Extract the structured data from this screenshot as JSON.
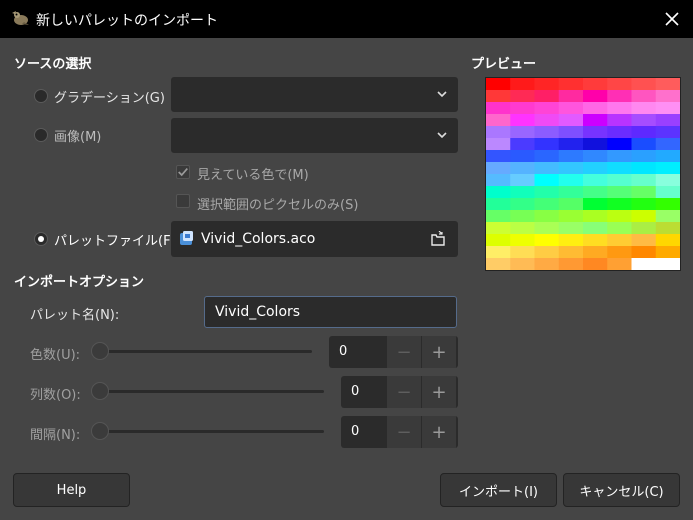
{
  "window": {
    "title": "新しいパレットのインポート",
    "app_icon": "gimp-wilber-icon",
    "close_icon": "close-icon"
  },
  "source": {
    "heading": "ソースの選択",
    "gradient": {
      "label": "グラデーション(G)",
      "selected": false,
      "value": ""
    },
    "image": {
      "label": "画像(M)",
      "selected": false,
      "value": ""
    },
    "visible_colors": {
      "label": "見えている色で(M)",
      "checked": true
    },
    "selection_only": {
      "label": "選択範囲のピクセルのみ(S)",
      "checked": false
    },
    "palette_file": {
      "label": "パレットファイル(F)",
      "selected": true,
      "file_name": "Vivid_Colors.aco"
    }
  },
  "preview": {
    "heading": "プレビュー",
    "swatches": [
      "#ff0000",
      "#ff1a1a",
      "#ff2525",
      "#ff3030",
      "#ff3b3b",
      "#ff4646",
      "#ff5151",
      "#ff5c5c",
      "#ff3838",
      "#ff2a55",
      "#ff1f66",
      "#ff2aa0",
      "#ff00aa",
      "#ff2fb5",
      "#ff55c0",
      "#ff70cc",
      "#ff33cc",
      "#ff3ad0",
      "#ff44d6",
      "#ff55dd",
      "#ff66e6",
      "#ff77ee",
      "#ff88f0",
      "#ff8ff4",
      "#ff66cc",
      "#ff33ff",
      "#f04af5",
      "#e25aff",
      "#cc00ff",
      "#b833ff",
      "#a64dff",
      "#9a40ff",
      "#aa77ff",
      "#9966ff",
      "#8c5cff",
      "#7f4fff",
      "#7733ff",
      "#6a2cff",
      "#5e29ff",
      "#5c33ff",
      "#bb88ff",
      "#4b3bff",
      "#3333ff",
      "#2222ee",
      "#1111dd",
      "#0000ff",
      "#1a4dff",
      "#3366ff",
      "#3355ff",
      "#2a5aff",
      "#2a66ff",
      "#2d7aff",
      "#3088ff",
      "#3399ff",
      "#2aa0ff",
      "#22aaff",
      "#66aaff",
      "#55b3ff",
      "#44bbff",
      "#33c6ff",
      "#22d0ff",
      "#11ddff",
      "#00e6ff",
      "#00eeff",
      "#55bbff",
      "#66ccff",
      "#00ffff",
      "#22ffee",
      "#44ffdd",
      "#55ffd0",
      "#66ffcc",
      "#88ffdd",
      "#00ffcc",
      "#11ffbb",
      "#22ffaa",
      "#33ff99",
      "#44ff88",
      "#55ff77",
      "#66ff66",
      "#66ffcc",
      "#22ff99",
      "#33ff88",
      "#44ff77",
      "#55ff66",
      "#00ff33",
      "#11ff22",
      "#22ff11",
      "#33ff00",
      "#66ff66",
      "#77ff55",
      "#88ff44",
      "#99ff33",
      "#aaff22",
      "#bbff11",
      "#ccff00",
      "#99ff66",
      "#ccff33",
      "#bbff44",
      "#aaff55",
      "#99ff66",
      "#88ff77",
      "#99ff55",
      "#aaee44",
      "#bbdd33",
      "#ddff00",
      "#eeff00",
      "#ffff00",
      "#ffee11",
      "#ffdd22",
      "#ffcc33",
      "#ffbb44",
      "#ffd700",
      "#ffee66",
      "#ffdd55",
      "#ffcc44",
      "#ffbb33",
      "#ffaa22",
      "#ff9911",
      "#ff8800",
      "#ffaa00",
      "#ffcc66",
      "#ffbb55",
      "#ffaa44",
      "#ff9933",
      "#ff8822",
      "#ffa033",
      "#ffffff",
      "#ffffff"
    ]
  },
  "options": {
    "heading": "インポートオプション",
    "palette_name": {
      "label": "パレット名(N):",
      "value": "Vivid_Colors"
    },
    "num_colors": {
      "label": "色数(U):",
      "value": "0",
      "slider_fraction": 0
    },
    "columns": {
      "label": "列数(O):",
      "value": "0",
      "slider_fraction": 0
    },
    "interval": {
      "label": "間隔(N):",
      "value": "0",
      "slider_fraction": 0
    },
    "minus_symbol": "−",
    "plus_symbol": "+"
  },
  "buttons": {
    "help": "Help",
    "import": "インポート(I)",
    "cancel": "キャンセル(C)"
  }
}
